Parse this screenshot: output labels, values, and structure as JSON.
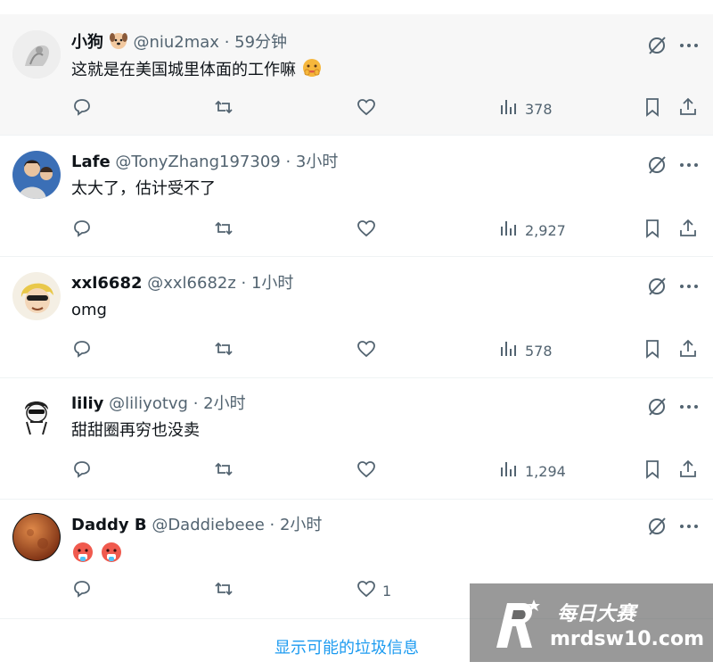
{
  "tweets": [
    {
      "name": "小狗",
      "handle": "@niu2max",
      "time": "· 59分钟",
      "text": "这就是在美国城里体面的工作嘛",
      "likes": "",
      "views": "378"
    },
    {
      "name": "Lafe",
      "handle": "@TonyZhang197309",
      "time": "· 3小时",
      "text": "太大了，估计受不了",
      "likes": "",
      "views": "2,927"
    },
    {
      "name": "xxl6682",
      "handle": "@xxl6682z",
      "time": "· 1小时",
      "text": "omg",
      "likes": "",
      "views": "578"
    },
    {
      "name": "liliy",
      "handle": "@liliyotvg",
      "time": "· 2小时",
      "text": "甜甜圈再穷也没卖",
      "likes": "",
      "views": "1,294"
    },
    {
      "name": "Daddy B",
      "handle": "@Daddiebeee",
      "time": "· 2小时",
      "text": "",
      "likes": "1",
      "views": ""
    }
  ],
  "spam_link": "显示可能的垃圾信息",
  "watermark": {
    "title": "每日大赛",
    "url": "mrdsw10.com"
  },
  "icons": {
    "reply": "reply-icon",
    "retweet": "retweet-icon",
    "like": "heart-icon",
    "views": "views-icon",
    "bookmark": "bookmark-icon",
    "share": "share-icon",
    "grok": "grok-icon",
    "more": "more-icon"
  },
  "colors": {
    "link": "#1d9bf0",
    "secondary_text": "#536471",
    "hover_background": "#f7f7f7"
  }
}
